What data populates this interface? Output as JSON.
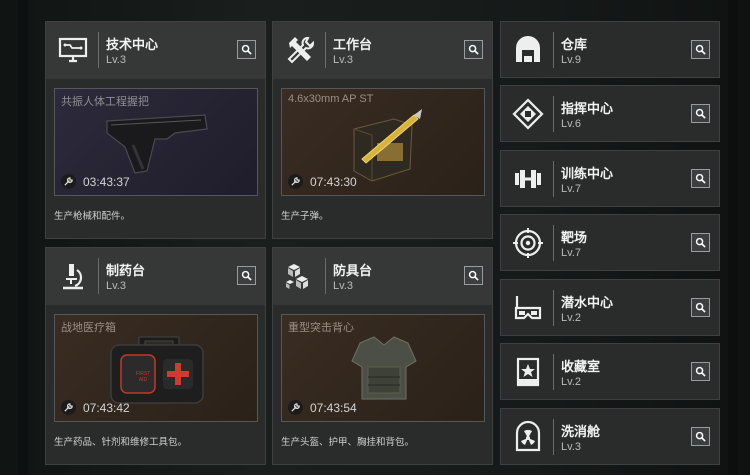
{
  "cards_big": [
    {
      "title": "技术中心",
      "level": "Lv.3",
      "slot_item": "共振人体工程握把",
      "time": "03:43:37",
      "desc": "生产枪械和配件。",
      "icon": "monitor-icon"
    },
    {
      "title": "工作台",
      "level": "Lv.3",
      "slot_item": "4.6x30mm AP ST",
      "time": "07:43:30",
      "desc": "生产子弹。",
      "icon": "tools-icon"
    },
    {
      "title": "制药台",
      "level": "Lv.3",
      "slot_item": "战地医疗箱",
      "time": "07:43:42",
      "desc": "生产药品、针剂和维修工具包。",
      "icon": "microscope-icon"
    },
    {
      "title": "防具台",
      "level": "Lv.3",
      "slot_item": "重型突击背心",
      "time": "07:43:54",
      "desc": "生产头盔、护甲、胸挂和背包。",
      "icon": "cubes-icon"
    }
  ],
  "cards_small": [
    {
      "title": "仓库",
      "level": "Lv.9",
      "icon": "warehouse-icon"
    },
    {
      "title": "指挥中心",
      "level": "Lv.6",
      "icon": "command-icon"
    },
    {
      "title": "训练中心",
      "level": "Lv.7",
      "icon": "dumbbell-icon"
    },
    {
      "title": "靶场",
      "level": "Lv.7",
      "icon": "target-icon"
    },
    {
      "title": "潜水中心",
      "level": "Lv.2",
      "icon": "diving-mask-icon"
    },
    {
      "title": "收藏室",
      "level": "Lv.2",
      "icon": "collection-icon"
    },
    {
      "title": "洗消舱",
      "level": "Lv.3",
      "icon": "decontamination-icon"
    }
  ],
  "medkit_label": "FIRST AID",
  "colors": {
    "panel": "#2a2c2c",
    "header": "#363838",
    "purple_slot": "#2d2a3b",
    "brown_slot": "#3a2d22"
  }
}
